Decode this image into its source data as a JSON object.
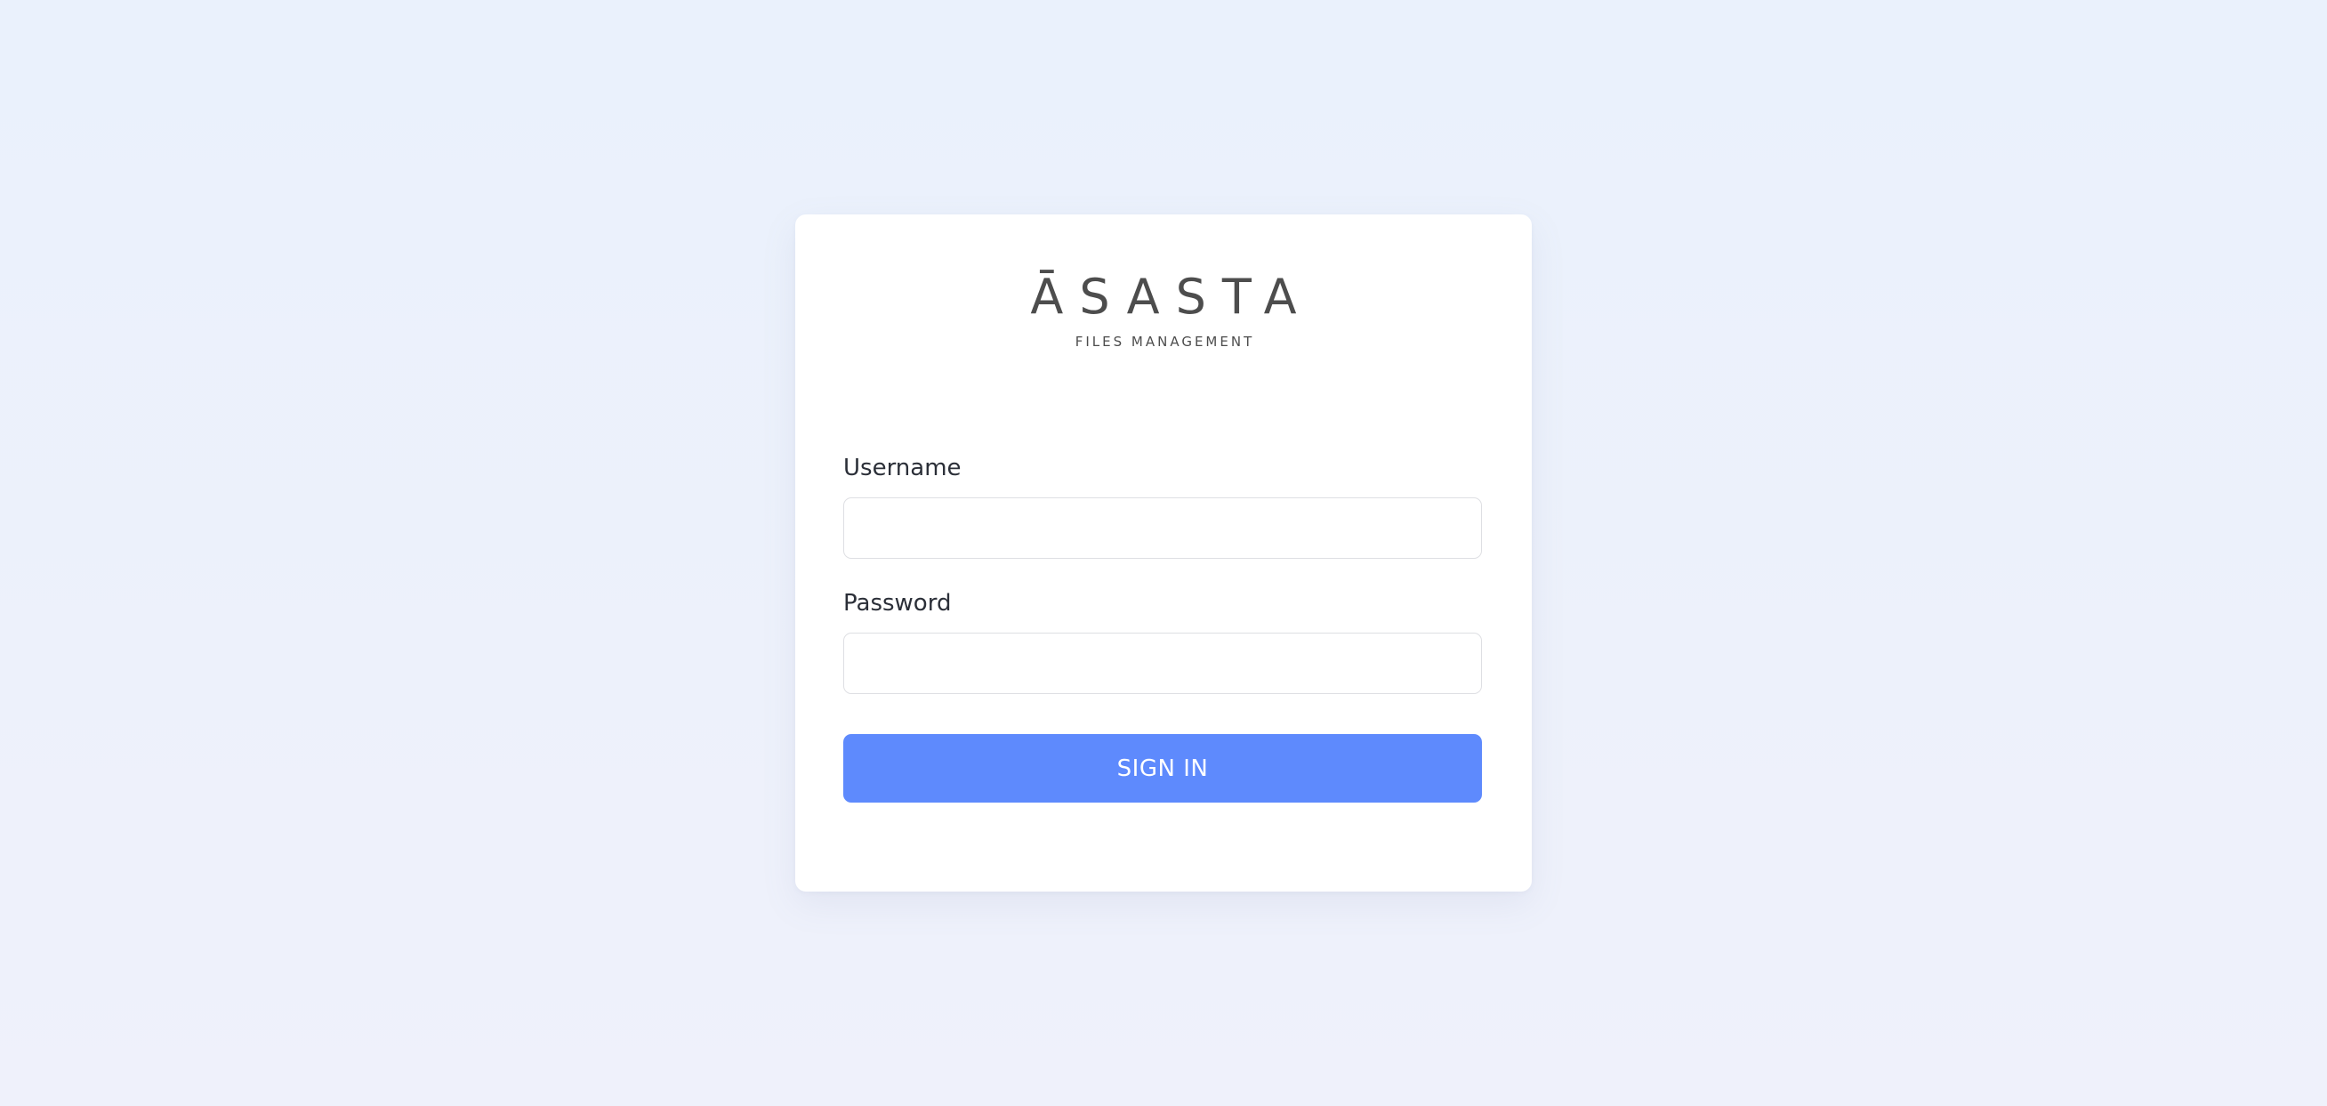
{
  "brand": {
    "name": "ĀSASTA",
    "tagline": "FILES MANAGEMENT"
  },
  "login_form": {
    "username_label": "Username",
    "username_value": "",
    "password_label": "Password",
    "password_value": "",
    "submit_label": "SIGN IN"
  },
  "colors": {
    "background": "#eaf1fc",
    "card": "#ffffff",
    "button": "#5e8afd",
    "button_text": "#ffffff",
    "logo": "#4d4d4d",
    "label": "#2b2f38",
    "input_border": "#dedfe3"
  }
}
